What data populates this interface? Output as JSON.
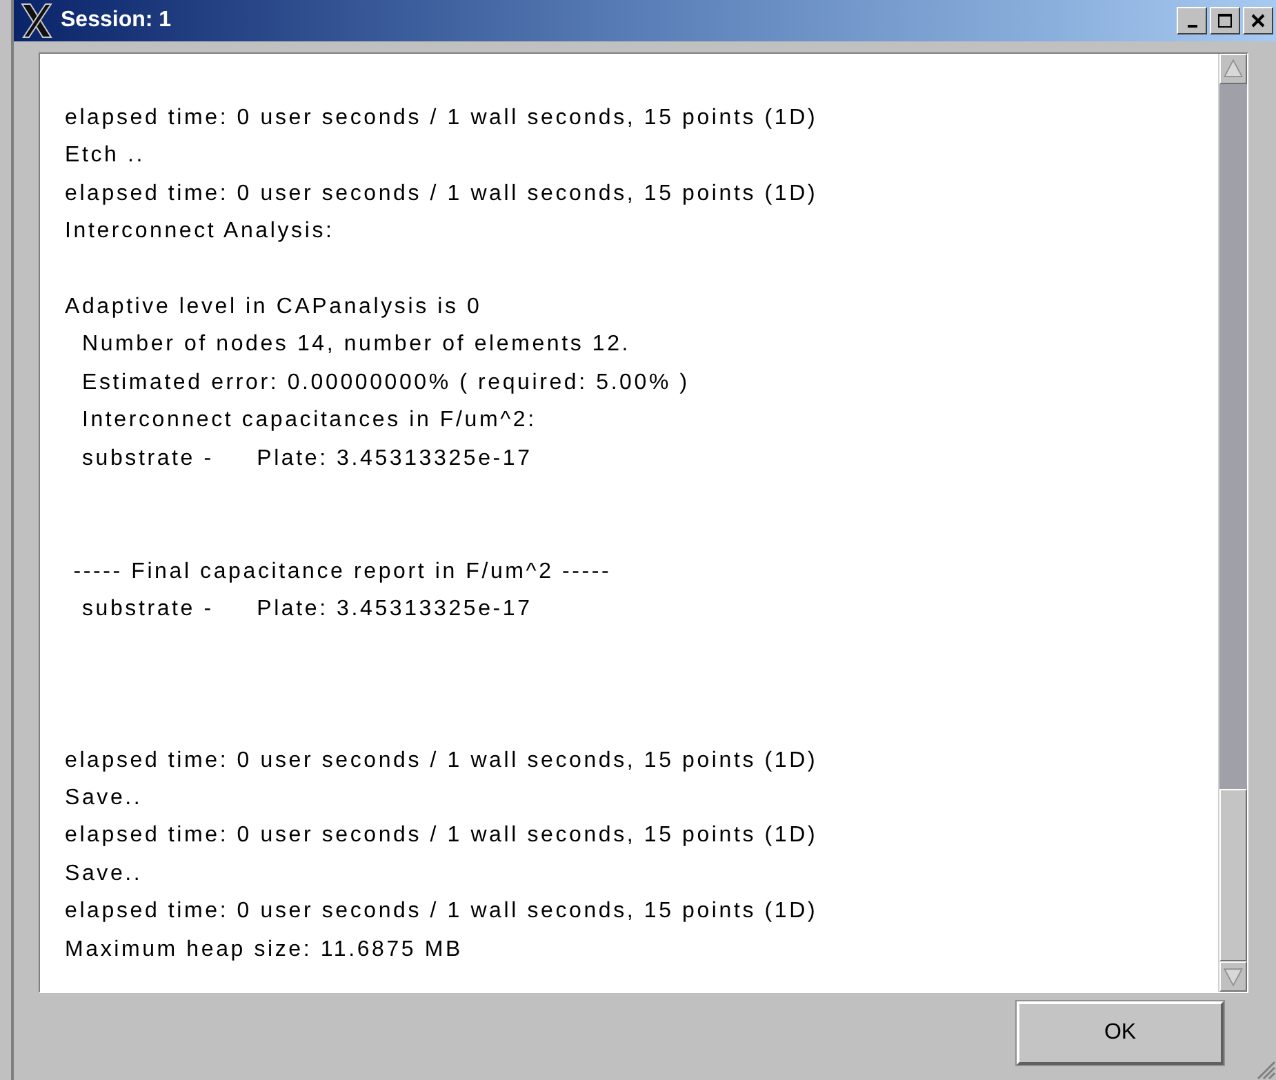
{
  "window": {
    "title": "Session: 1"
  },
  "log": [
    {
      "kind": "line",
      "text": "elapsed time: 0 user seconds / 1 wall seconds, 15 points (1D)"
    },
    {
      "kind": "line",
      "text": "Etch .."
    },
    {
      "kind": "line",
      "text": "elapsed time: 0 user seconds / 1 wall seconds, 15 points (1D)"
    },
    {
      "kind": "line",
      "text": "Interconnect Analysis:"
    },
    {
      "kind": "blank"
    },
    {
      "kind": "line",
      "text": "Adaptive level in CAPanalysis is 0"
    },
    {
      "kind": "line",
      "text": "  Number of nodes 14, number of elements 12."
    },
    {
      "kind": "line",
      "text": "  Estimated error: 0.00000000% ( required: 5.00% )"
    },
    {
      "kind": "line",
      "text": "  Interconnect capacitances in F/um^2:"
    },
    {
      "kind": "line",
      "text": "  substrate -     Plate: 3.45313325e-17"
    },
    {
      "kind": "blank"
    },
    {
      "kind": "blank"
    },
    {
      "kind": "line",
      "text": " ----- Final capacitance report in F/um^2 -----"
    },
    {
      "kind": "line",
      "text": "  substrate -     Plate: 3.45313325e-17"
    },
    {
      "kind": "blank"
    },
    {
      "kind": "blank"
    },
    {
      "kind": "blank"
    },
    {
      "kind": "line",
      "text": "elapsed time: 0 user seconds / 1 wall seconds, 15 points (1D)"
    },
    {
      "kind": "line",
      "text": "Save.."
    },
    {
      "kind": "line",
      "text": "elapsed time: 0 user seconds / 1 wall seconds, 15 points (1D)"
    },
    {
      "kind": "line",
      "text": "Save.."
    },
    {
      "kind": "line",
      "text": "elapsed time: 0 user seconds / 1 wall seconds, 15 points (1D)"
    },
    {
      "kind": "line",
      "text": "Maximum heap size: 11.6875 MB"
    }
  ],
  "buttons": [
    {
      "label": "OK"
    }
  ]
}
